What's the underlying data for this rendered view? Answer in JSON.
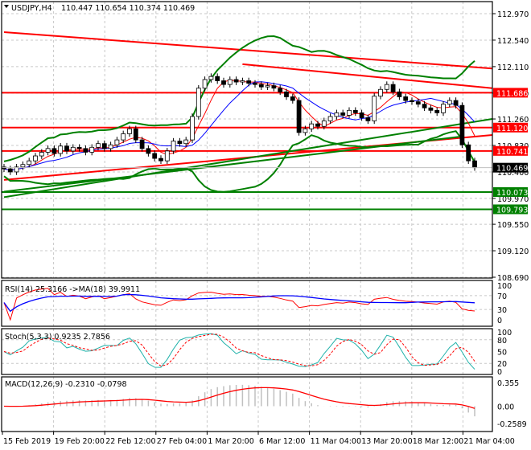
{
  "header": {
    "symbol_timeframe": "USDJPY,H4",
    "ohlc": "110.447 110.654 110.374 110.469"
  },
  "chart_data": {
    "type": "candlestick",
    "symbol": "USDJPY",
    "timeframe": "H4",
    "grid": true,
    "ylim": [
      108.69,
      112.97
    ],
    "y_ticks": [
      "112.970",
      "112.540",
      "112.110",
      "111.680",
      "111.260",
      "110.830",
      "110.400",
      "109.970",
      "109.550",
      "109.120",
      "108.690"
    ],
    "x_tick_labels": [
      "15 Feb 2019",
      "19 Feb 20:00",
      "22 Feb 12:00",
      "27 Feb 04:00",
      "1 Mar 20:00",
      "6 Mar 12:00",
      "11 Mar 04:00",
      "13 Mar 20:00",
      "18 Mar 12:00",
      "21 Mar 04:00"
    ],
    "close": [
      110.45,
      110.4,
      110.48,
      110.52,
      110.58,
      110.66,
      110.72,
      110.78,
      110.7,
      110.82,
      110.74,
      110.8,
      110.78,
      110.72,
      110.8,
      110.86,
      110.78,
      110.84,
      110.92,
      111.02,
      111.1,
      110.92,
      110.78,
      110.7,
      110.62,
      110.58,
      110.74,
      110.9,
      110.86,
      110.92,
      111.3,
      111.76,
      111.9,
      111.95,
      111.88,
      111.82,
      111.9,
      111.86,
      111.88,
      111.84,
      111.82,
      111.78,
      111.8,
      111.76,
      111.7,
      111.62,
      111.56,
      111.04,
      111.1,
      111.18,
      111.14,
      111.23,
      111.3,
      111.36,
      111.32,
      111.4,
      111.36,
      111.28,
      111.23,
      111.63,
      111.74,
      111.82,
      111.7,
      111.62,
      111.56,
      111.54,
      111.5,
      111.44,
      111.4,
      111.36,
      111.5,
      111.56,
      111.48,
      110.84,
      110.58,
      110.469
    ],
    "last_price": {
      "value": "110.469",
      "color": "#000000"
    },
    "horizontal_levels": [
      {
        "value": "111.686",
        "color": "#ff0000"
      },
      {
        "value": "111.120",
        "color": "#ff0000"
      },
      {
        "value": "110.741",
        "color": "#ff0000"
      },
      {
        "value": "110.073",
        "color": "#008000"
      },
      {
        "value": "109.793",
        "color": "#008000"
      }
    ],
    "trendlines": [
      {
        "color": "#ff0000",
        "from": [
          0,
          112.67
        ],
        "to": [
          77.8,
          112.08
        ]
      },
      {
        "color": "#ff0000",
        "from": [
          38,
          112.15
        ],
        "to": [
          77.8,
          111.76
        ]
      },
      {
        "color": "#ff0000",
        "from": [
          0,
          110.27
        ],
        "to": [
          77.8,
          111.0
        ]
      },
      {
        "color": "#008000",
        "from": [
          0,
          109.99
        ],
        "to": [
          77.8,
          111.26
        ]
      },
      {
        "color": "#008000",
        "from": [
          0,
          110.08
        ],
        "to": [
          72.5,
          110.97
        ]
      }
    ],
    "bollinger_color": "#008000",
    "ma_colors": [
      "#ff0000",
      "#0000ff"
    ],
    "indicators": {
      "rsi": {
        "label": "RSI(14) 25.3166  ->MA(18) 39.9911",
        "ticks": [
          "100",
          "70",
          "30",
          "0"
        ],
        "rsi_color": "#ff0000",
        "ma_color": "#0000ff"
      },
      "stoch": {
        "label": "Stoch(5,3,3) 0.9235 2.7856",
        "ticks": [
          "100",
          "80",
          "50",
          "20",
          "0"
        ],
        "main_color": "#20b2aa",
        "signal_color": "#ff0000"
      },
      "macd": {
        "label": "MACD(12,26,9) -0.2310 -0.0798",
        "ticks": [
          "0.355",
          "0.00",
          "-0.2589"
        ],
        "range": [
          -0.2589,
          0.355
        ],
        "hist_color": "#c0c0c0",
        "signal_color": "#ff0000"
      }
    }
  }
}
